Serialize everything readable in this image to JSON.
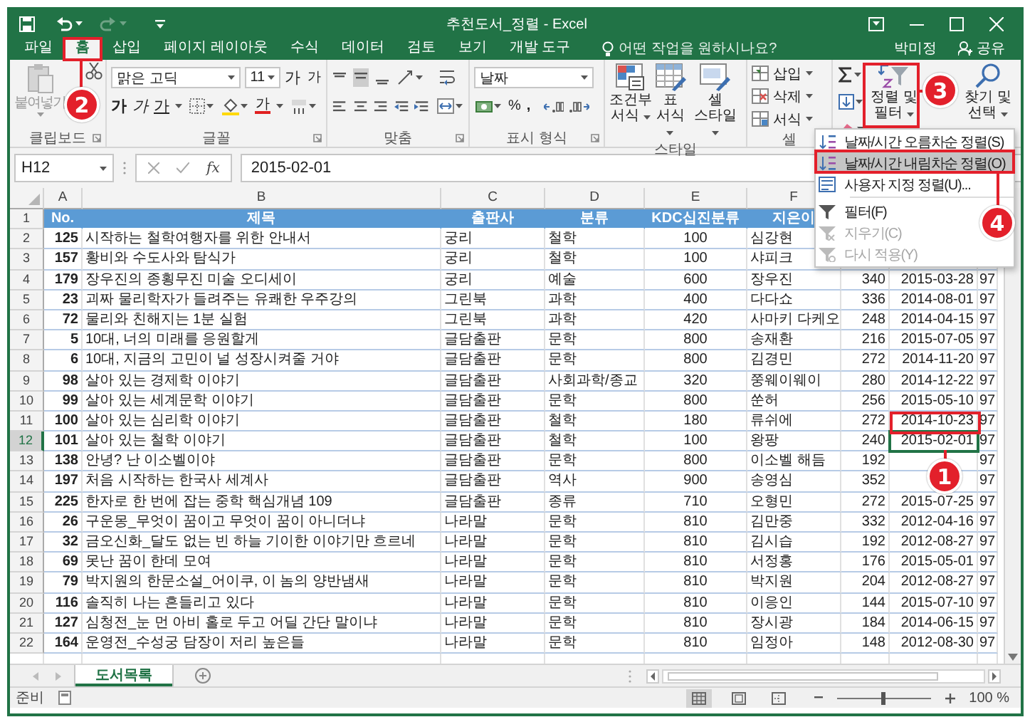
{
  "window": {
    "title": "추천도서_정렬 - Excel"
  },
  "tabs": [
    {
      "label": "파일",
      "selected": false
    },
    {
      "label": "홈",
      "selected": true
    },
    {
      "label": "삽입",
      "selected": false
    },
    {
      "label": "페이지 레이아웃",
      "selected": false
    },
    {
      "label": "수식",
      "selected": false
    },
    {
      "label": "데이터",
      "selected": false
    },
    {
      "label": "검토",
      "selected": false
    },
    {
      "label": "보기",
      "selected": false
    },
    {
      "label": "개발 도구",
      "selected": false
    }
  ],
  "tell_me": {
    "placeholder": "어떤 작업을 원하시나요?"
  },
  "account": {
    "user": "박미정",
    "share": "공유"
  },
  "ribbon": {
    "clipboard": {
      "label": "클립보드",
      "paste": "붙여넣기"
    },
    "font": {
      "label": "글꼴",
      "font_name": "맑은 고딕",
      "font_size": "11",
      "grow": "가",
      "shrink": "가",
      "bold": "가",
      "italic": "가",
      "underline": "가",
      "font_color": "가"
    },
    "alignment": {
      "label": "맞춤"
    },
    "number": {
      "label": "표시 형식",
      "format": "날짜",
      "percent": "%",
      "comma": ","
    },
    "styles": {
      "label": "스타일",
      "buttons": [
        "조건부 서식",
        "표 서식",
        "셀 스타일"
      ]
    },
    "cells": {
      "label": "셀",
      "buttons": [
        "삽입",
        "삭제",
        "서식"
      ]
    },
    "editing": {
      "buttons": [
        "정렬 및 필터",
        "찾기 및 선택"
      ]
    }
  },
  "formula_bar": {
    "name_box": "H12",
    "function_button": "fx",
    "value": "2015-02-01"
  },
  "sheet": {
    "columns": [
      "A",
      "B",
      "C",
      "D",
      "E",
      "F"
    ],
    "rows": [
      {
        "number": "1",
        "selected": false,
        "cells": [
          "No.",
          "제목",
          "출판사",
          "분류",
          "KDC십진분류",
          "지은이",
          null,
          null,
          null
        ]
      },
      {
        "number": "2",
        "selected": false,
        "cells": [
          "125",
          "시작하는 철학여행자를 위한 안내서",
          "궁리",
          "철학",
          "100",
          "심강현",
          null,
          null,
          null
        ]
      },
      {
        "number": "3",
        "selected": false,
        "cells": [
          "157",
          "황비와 수도사와 탐식가",
          "궁리",
          "철학",
          "100",
          "샤피크",
          null,
          null,
          null
        ]
      },
      {
        "number": "4",
        "selected": false,
        "cells": [
          "179",
          "장우진의 종횡무진 미술 오디세이",
          "궁리",
          "예술",
          "600",
          "장우진",
          "340",
          "2015-03-28",
          "97"
        ]
      },
      {
        "number": "5",
        "selected": false,
        "cells": [
          "23",
          "괴짜 물리학자가 들려주는 유쾌한 우주강의",
          "그린북",
          "과학",
          "400",
          "다다쇼",
          "336",
          "2014-08-01",
          "97"
        ]
      },
      {
        "number": "6",
        "selected": false,
        "cells": [
          "72",
          "물리와 친해지는 1분 실험",
          "그린북",
          "과학",
          "420",
          "사마키 다케오",
          "248",
          "2014-04-15",
          "97"
        ]
      },
      {
        "number": "7",
        "selected": false,
        "cells": [
          "5",
          "10대, 너의 미래를 응원할게",
          "글담출판",
          "문학",
          "800",
          "송재환",
          "216",
          "2015-07-05",
          "97"
        ]
      },
      {
        "number": "8",
        "selected": false,
        "cells": [
          "6",
          "10대, 지금의 고민이 널 성장시켜줄 거야",
          "글담출판",
          "문학",
          "800",
          "김경민",
          "272",
          "2014-11-20",
          "97"
        ]
      },
      {
        "number": "9",
        "selected": false,
        "cells": [
          "98",
          "살아 있는 경제학 이야기",
          "글담출판",
          "사회과학/종교",
          "320",
          "쭝웨이웨이",
          "280",
          "2014-12-22",
          "97"
        ]
      },
      {
        "number": "10",
        "selected": false,
        "cells": [
          "99",
          "살아 있는 세계문학 이야기",
          "글담출판",
          "문학",
          "800",
          "쑨허",
          "256",
          "2015-05-10",
          "97"
        ]
      },
      {
        "number": "11",
        "selected": false,
        "cells": [
          "100",
          "살아 있는 심리학 이야기",
          "글담출판",
          "철학",
          "180",
          "류쉬에",
          "272",
          "2014-10-23",
          "97"
        ]
      },
      {
        "number": "12",
        "selected": true,
        "cells": [
          "101",
          "살아 있는 철학 이야기",
          "글담출판",
          "철학",
          "100",
          "왕팡",
          "240",
          "2015-02-01",
          "97"
        ]
      },
      {
        "number": "13",
        "selected": false,
        "cells": [
          "138",
          "안녕? 난 이소벨이야",
          "글담출판",
          "문학",
          "800",
          "이소벨 해듬",
          "192",
          null,
          "97"
        ]
      },
      {
        "number": "14",
        "selected": false,
        "cells": [
          "197",
          "처음 시작하는 한국사 세계사",
          "글담출판",
          "역사",
          "900",
          "송영심",
          "352",
          null,
          "97"
        ]
      },
      {
        "number": "15",
        "selected": false,
        "cells": [
          "225",
          "한자로 한 번에 잡는 중학 핵심개념 109",
          "글담출판",
          "종류",
          "710",
          "오형민",
          "272",
          "2015-07-25",
          "97"
        ]
      },
      {
        "number": "16",
        "selected": false,
        "cells": [
          "26",
          "구운몽_무엇이 꿈이고 무엇이 꿈이 아니더냐",
          "나라말",
          "문학",
          "810",
          "김만중",
          "332",
          "2012-04-16",
          "97"
        ]
      },
      {
        "number": "17",
        "selected": false,
        "cells": [
          "32",
          "금오신화_달도 없는 빈 하늘 기이한 이야기만 흐르네",
          "나라말",
          "문학",
          "810",
          "김시습",
          "192",
          "2012-08-27",
          "97"
        ]
      },
      {
        "number": "18",
        "selected": false,
        "cells": [
          "69",
          "못난 꿈이 한데 모여",
          "나라말",
          "문학",
          "810",
          "서정홍",
          "176",
          "2015-05-01",
          "97"
        ]
      },
      {
        "number": "19",
        "selected": false,
        "cells": [
          "79",
          "박지원의 한문소설_어이쿠, 이 놈의 양반냄새",
          "나라말",
          "문학",
          "810",
          "박지원",
          "204",
          "2012-08-27",
          "97"
        ]
      },
      {
        "number": "20",
        "selected": false,
        "cells": [
          "116",
          "솔직히 나는 흔들리고 있다",
          "나라말",
          "문학",
          "810",
          "이응인",
          "144",
          "2015-07-10",
          "97"
        ]
      },
      {
        "number": "21",
        "selected": false,
        "cells": [
          "127",
          "심청전_눈 먼 아비 홀로 두고 어딜 간단 말이냐",
          "나라말",
          "문학",
          "810",
          "장시광",
          "184",
          "2014-06-15",
          "97"
        ]
      },
      {
        "number": "22",
        "selected": false,
        "cells": [
          "164",
          "운영전_수성궁 담장이 저리 높은들",
          "나라말",
          "문학",
          "810",
          "임정아",
          "148",
          "2012-08-30",
          "97"
        ]
      }
    ]
  },
  "sort_menu": {
    "items": [
      {
        "kind": "item",
        "label": "날짜/시간 오름차순 정렬(S)",
        "selected": false,
        "disabled": false
      },
      {
        "kind": "item",
        "label": "날짜/시간 내림차순 정렬(O)",
        "selected": true,
        "disabled": false
      },
      {
        "kind": "item",
        "label": "사용자 지정 정렬(U)...",
        "selected": false,
        "disabled": false
      },
      {
        "kind": "separator"
      },
      {
        "kind": "item",
        "label": "필터(F)",
        "selected": false,
        "disabled": false
      },
      {
        "kind": "item",
        "label": "지우기(C)",
        "selected": false,
        "disabled": true
      },
      {
        "kind": "item",
        "label": "다시 적용(Y)",
        "selected": false,
        "disabled": true
      }
    ]
  },
  "sheet_tabs": [
    {
      "label": "도서목록",
      "selected": true
    }
  ],
  "status_bar": {
    "status": "준비",
    "view_buttons": [
      {
        "selected": true
      },
      {
        "selected": false
      },
      {
        "selected": false
      }
    ],
    "zoom": {
      "level": 0.5
    },
    "zoom_label": "100 %"
  },
  "callouts": [
    {
      "label": "1"
    },
    {
      "label": "2"
    },
    {
      "label": "3"
    },
    {
      "label": "4"
    }
  ]
}
